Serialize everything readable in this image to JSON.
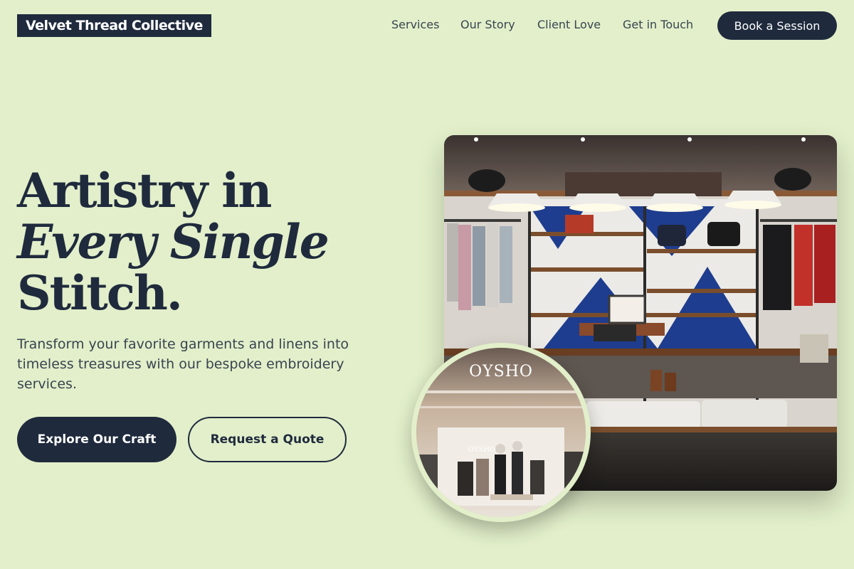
{
  "header": {
    "brand": "Velvet Thread Collective",
    "nav": [
      "Services",
      "Our Story",
      "Client Love",
      "Get in Touch"
    ],
    "cta_label": "Book a Session"
  },
  "hero": {
    "headline_line1": "Artistry in",
    "headline_line2": "Every Single",
    "headline_line3": "Stitch.",
    "lede": "Transform your favorite garments and linens into timeless treasures with our bespoke embroidery services.",
    "primary_label": "Explore Our Craft",
    "secondary_label": "Request a Quote"
  },
  "images": {
    "main_alt": "Clothing boutique interior with hanging lamps, shelves and garment racks",
    "inset_sign": "OYSHO",
    "inset_sign_small": "OYSHO"
  },
  "colors": {
    "background": "#e2efca",
    "navy": "#1f2a3d",
    "text_muted": "#3a4350"
  }
}
